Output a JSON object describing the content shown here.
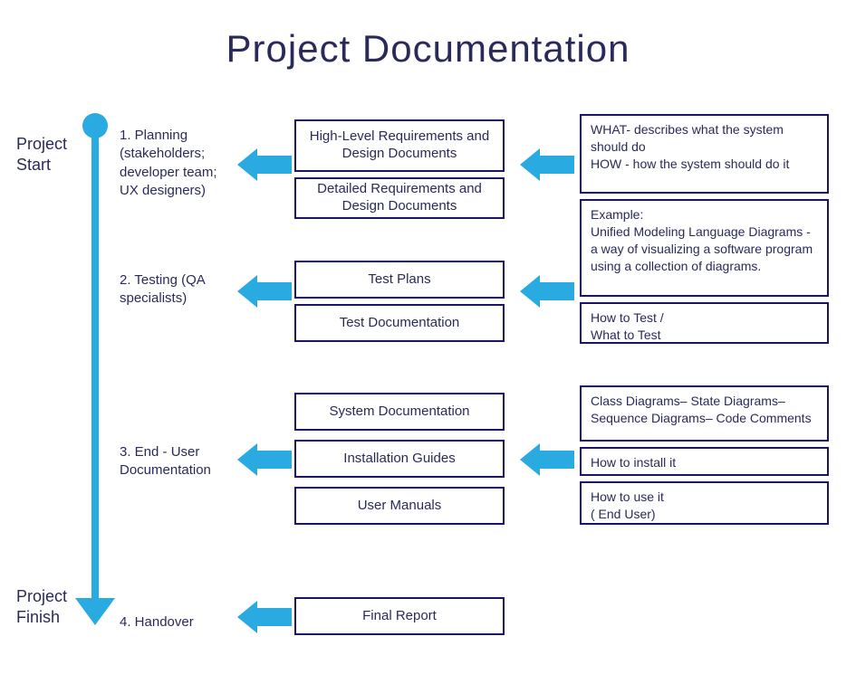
{
  "title": "Project  Documentation",
  "timeline": {
    "start": "Project Start",
    "finish": "Project Finish"
  },
  "stages": {
    "s1": "1. Planning (stakeholders; developer team; UX designers)",
    "s2": "2. Testing (QA specialists)",
    "s3": "3. End - User Documentation",
    "s4": "4. Handover"
  },
  "docs": {
    "d1": "High-Level Requirements and Design Documents",
    "d2": "Detailed Requirements and Design Documents",
    "d3": "Test Plans",
    "d4": "Test Documentation",
    "d5": "System  Documentation",
    "d6": "Installation Guides",
    "d7": "User Manuals",
    "d8": "Final Report"
  },
  "desc": {
    "r1": "WHAT- describes what the system should do\nHOW - how the system should do it",
    "r2": "Example:\nUnified Modeling Language Diagrams - a way of visualizing a software program using a collection of diagrams.",
    "r3": "How to Test /\nWhat to Test",
    "r4": "Class Diagrams– State Diagrams– Sequence Diagrams– Code Comments",
    "r5": "How to install it",
    "r6": "How to use it\n( End User)"
  }
}
